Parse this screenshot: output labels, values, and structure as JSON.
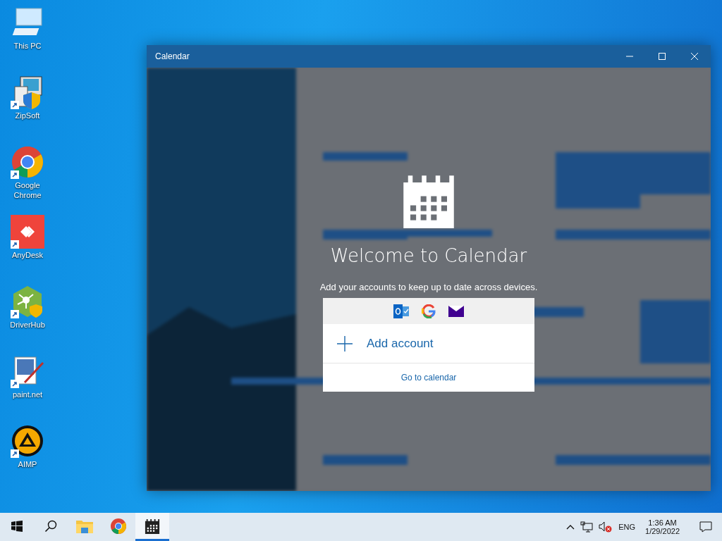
{
  "desktop_icons": [
    {
      "label": "This PC",
      "kind": "pc",
      "shortcut": false
    },
    {
      "label": "ZipSoft",
      "kind": "installer",
      "shortcut": true
    },
    {
      "label": "Google Chrome",
      "kind": "chrome",
      "shortcut": true
    },
    {
      "label": "AnyDesk",
      "kind": "anydesk",
      "shortcut": true
    },
    {
      "label": "DriverHub",
      "kind": "driverhub",
      "shortcut": true
    },
    {
      "label": "paint.net",
      "kind": "paint",
      "shortcut": true
    },
    {
      "label": "AIMP",
      "kind": "aimp",
      "shortcut": true
    }
  ],
  "window": {
    "title": "Calendar"
  },
  "welcome": {
    "title": "Welcome to Calendar",
    "subtitle": "Add your accounts to keep up to date across devices.",
    "add_account": "Add account",
    "go_to_calendar": "Go to calendar"
  },
  "taskbar": {
    "apps": [
      {
        "kind": "start",
        "selected": false
      },
      {
        "kind": "search",
        "selected": false
      },
      {
        "kind": "explorer",
        "selected": false
      },
      {
        "kind": "chrome",
        "selected": false
      },
      {
        "kind": "calendar",
        "selected": true
      }
    ],
    "language": "ENG",
    "time": "1:36 AM",
    "date": "1/29/2022"
  }
}
